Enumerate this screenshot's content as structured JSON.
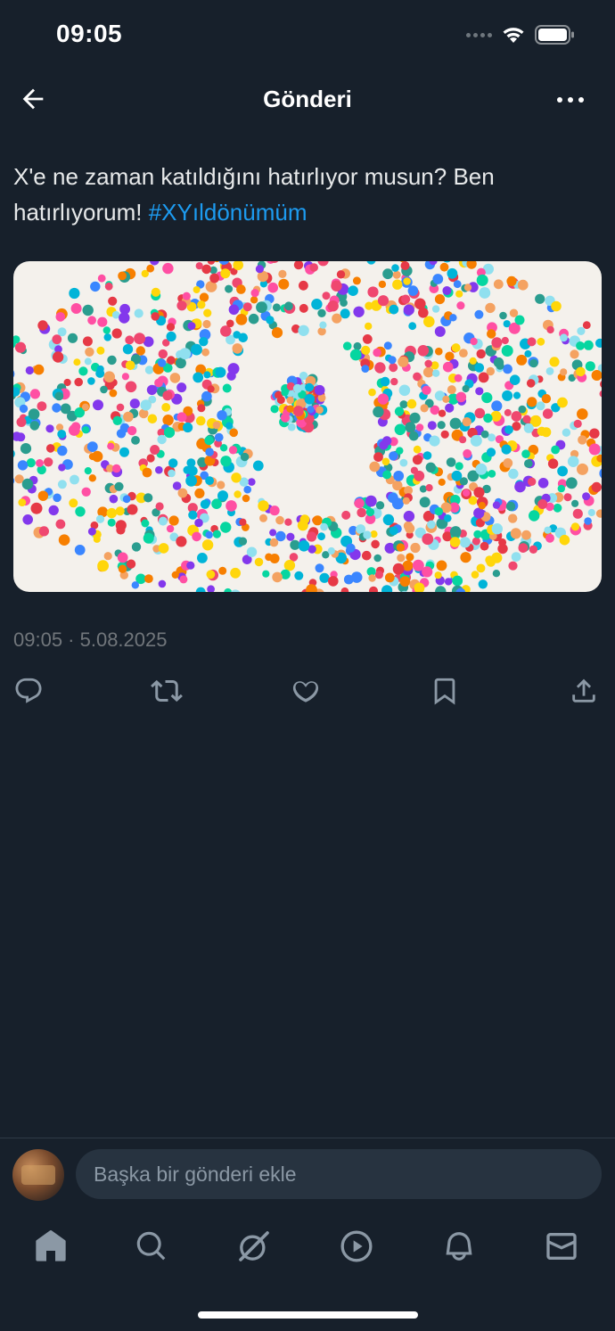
{
  "status_bar": {
    "time": "09:05"
  },
  "header": {
    "title": "Gönderi",
    "back_icon": "arrow-left-icon",
    "more_icon": "more-icon"
  },
  "post": {
    "text": "X'e ne zaman katıldığını hatırlıyor musun? Ben hatırlıyorum! ",
    "hashtag": "#XYıldönümüm",
    "image_alt_icon": "confetti-number-nine-image",
    "meta": "09:05 · 5.08.2025"
  },
  "actions": [
    {
      "icon": "reply-icon"
    },
    {
      "icon": "repost-icon"
    },
    {
      "icon": "like-icon"
    },
    {
      "icon": "bookmark-icon"
    },
    {
      "icon": "share-icon"
    }
  ],
  "reply": {
    "placeholder": "Başka bir gönderi ekle"
  },
  "tabbar": [
    {
      "icon": "home-icon"
    },
    {
      "icon": "search-icon"
    },
    {
      "icon": "grok-icon"
    },
    {
      "icon": "video-icon"
    },
    {
      "icon": "notifications-icon"
    },
    {
      "icon": "messages-icon"
    }
  ],
  "colors": {
    "background": "#17202b",
    "accent": "#1d9bf0",
    "muted": "#71767b"
  }
}
